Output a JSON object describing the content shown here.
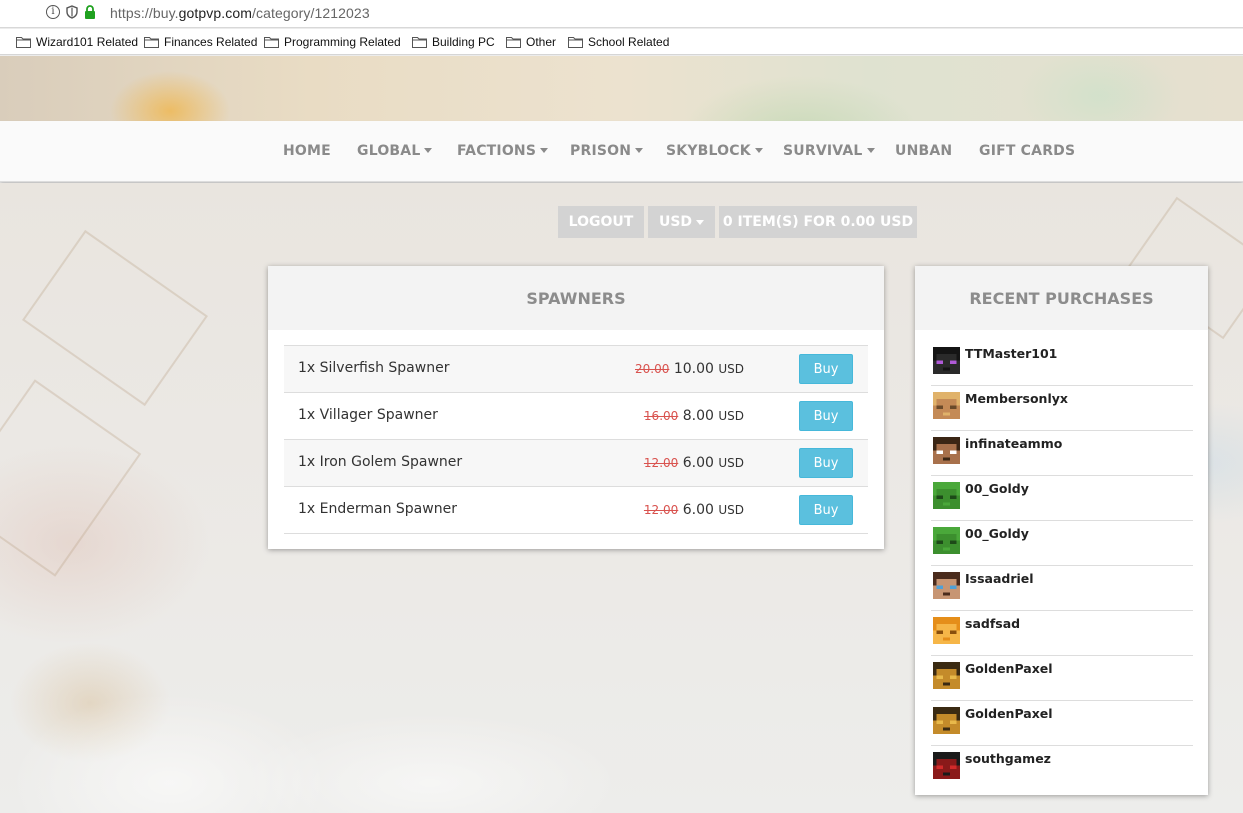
{
  "browser": {
    "url_prefix": "https://buy.",
    "url_host": "gotpvp.com",
    "url_path": "/category/1212023",
    "bookmarks": [
      {
        "label": "Wizard101 Related"
      },
      {
        "label": "Finances Related"
      },
      {
        "label": "Programming Related"
      },
      {
        "label": "Building PC"
      },
      {
        "label": "Other"
      },
      {
        "label": "School Related"
      }
    ]
  },
  "nav": {
    "items": [
      {
        "label": "HOME"
      },
      {
        "label": "GLOBAL"
      },
      {
        "label": "FACTIONS"
      },
      {
        "label": "PRISON"
      },
      {
        "label": "SKYBLOCK"
      },
      {
        "label": "SURVIVAL"
      },
      {
        "label": "UNBAN"
      },
      {
        "label": "GIFT CARDS"
      }
    ]
  },
  "actions": {
    "logout": "LOGOUT",
    "currency": "USD",
    "cart": "0 ITEM(S) FOR 0.00 USD"
  },
  "category": {
    "title": "SPAWNERS",
    "products": [
      {
        "name": "1x Silverfish Spawner",
        "old_price": "20.00",
        "price": "10.00",
        "currency": "USD",
        "buy": "Buy"
      },
      {
        "name": "1x Villager Spawner",
        "old_price": "16.00",
        "price": "8.00",
        "currency": "USD",
        "buy": "Buy"
      },
      {
        "name": "1x Iron Golem Spawner",
        "old_price": "12.00",
        "price": "6.00",
        "currency": "USD",
        "buy": "Buy"
      },
      {
        "name": "1x Enderman Spawner",
        "old_price": "12.00",
        "price": "6.00",
        "currency": "USD",
        "buy": "Buy"
      }
    ]
  },
  "recent": {
    "title": "RECENT PURCHASES",
    "items": [
      {
        "name": "TTMaster101",
        "skin": "enderman",
        "colors": [
          "#141414",
          "#2a2a2a",
          "#b05ad8"
        ]
      },
      {
        "name": "Membersonlyx",
        "skin": "blond",
        "colors": [
          "#e0b26a",
          "#c48a56",
          "#6a4a2a"
        ]
      },
      {
        "name": "infinateammo",
        "skin": "steve",
        "colors": [
          "#3b2615",
          "#a8714c",
          "#ffffff"
        ]
      },
      {
        "name": "00_Goldy",
        "skin": "slime",
        "colors": [
          "#4aa83a",
          "#3c8f2e",
          "#1d4a18"
        ]
      },
      {
        "name": "00_Goldy",
        "skin": "slime",
        "colors": [
          "#4aa83a",
          "#3c8f2e",
          "#1d4a18"
        ]
      },
      {
        "name": "Issaadriel",
        "skin": "brown",
        "colors": [
          "#4a2b1c",
          "#c79573",
          "#4fa0d6"
        ]
      },
      {
        "name": "sadfsad",
        "skin": "orange",
        "colors": [
          "#e58e1a",
          "#f6b648",
          "#8a4f0c"
        ]
      },
      {
        "name": "GoldenPaxel",
        "skin": "gold",
        "colors": [
          "#3a2a12",
          "#c48b2a",
          "#e8b94a"
        ]
      },
      {
        "name": "GoldenPaxel",
        "skin": "gold",
        "colors": [
          "#3a2a12",
          "#c48b2a",
          "#e8b94a"
        ]
      },
      {
        "name": "southgamez",
        "skin": "red",
        "colors": [
          "#1a1a1a",
          "#8a1a1a",
          "#d12a2a"
        ]
      }
    ]
  }
}
